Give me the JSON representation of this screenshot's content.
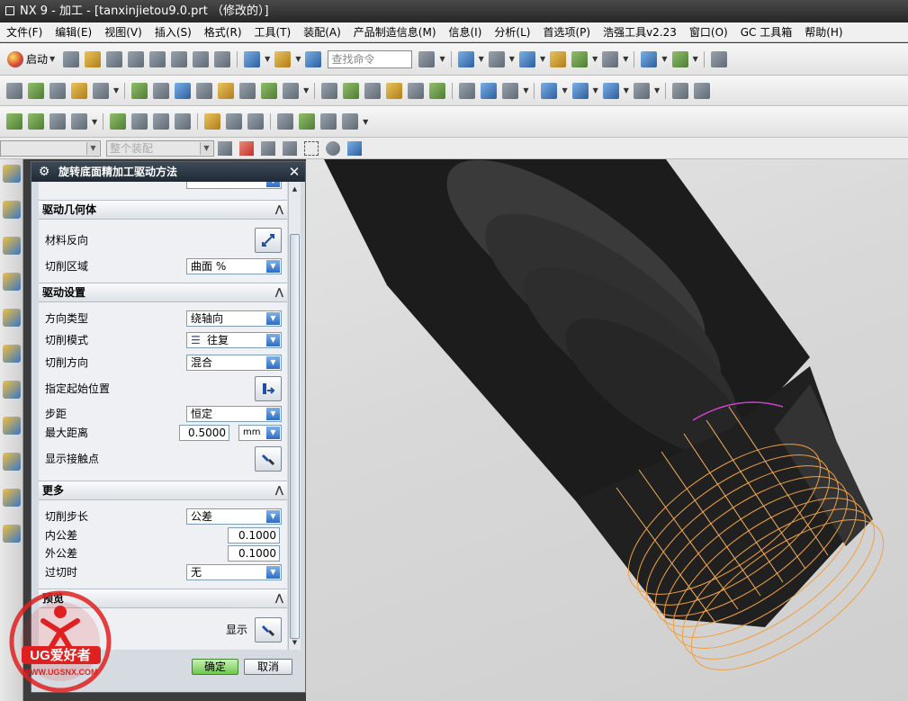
{
  "window": {
    "title": "NX 9 - 加工 - [tanxinjietou9.0.prt （修改的）]"
  },
  "menu": [
    "文件(F)",
    "编辑(E)",
    "视图(V)",
    "插入(S)",
    "格式(R)",
    "工具(T)",
    "装配(A)",
    "产品制造信息(M)",
    "信息(I)",
    "分析(L)",
    "首选项(P)",
    "浩强工具v2.23",
    "窗口(O)",
    "GC 工具箱",
    "帮助(H)"
  ],
  "toolbar": {
    "start_label": "启动",
    "search_placeholder": "查找命令"
  },
  "selection_bar": {
    "filter_value": "",
    "scope_value": "整个装配"
  },
  "dialog": {
    "title": "旋转底面精加工驱动方法",
    "sections": {
      "drive_geometry": "驱动几何体",
      "drive_settings": "驱动设置",
      "more": "更多",
      "preview": "预览"
    },
    "fields": {
      "material_reverse": "材料反向",
      "cut_region_label": "切削区域",
      "cut_region_value": "曲面 %",
      "direction_type_label": "方向类型",
      "direction_type_value": "绕轴向",
      "cut_mode_label": "切削模式",
      "cut_mode_value": "往复",
      "cut_direction_label": "切削方向",
      "cut_direction_value": "混合",
      "start_position_label": "指定起始位置",
      "stepover_label": "步距",
      "stepover_value": "恒定",
      "max_distance_label": "最大距离",
      "max_distance_value": "0.5000",
      "max_distance_unit": "mm",
      "show_contact_label": "显示接触点",
      "cut_step_label": "切削步长",
      "cut_step_value": "公差",
      "intol_label": "内公差",
      "intol_value": "0.1000",
      "outtol_label": "外公差",
      "outtol_value": "0.1000",
      "overcut_label": "过切时",
      "overcut_value": "无",
      "display_label": "显示"
    },
    "buttons": {
      "ok": "确定",
      "cancel": "取消"
    }
  },
  "watermark": {
    "brand": "UG爱好者",
    "url": "WWW.UGSNX.COM"
  },
  "colors": {
    "titlebar": "#2e2e2e",
    "dialog_header": "#1f2a36",
    "toolpath": "#f0a040",
    "part": "#2b2b2b",
    "ok_button": "#6ec84d"
  }
}
